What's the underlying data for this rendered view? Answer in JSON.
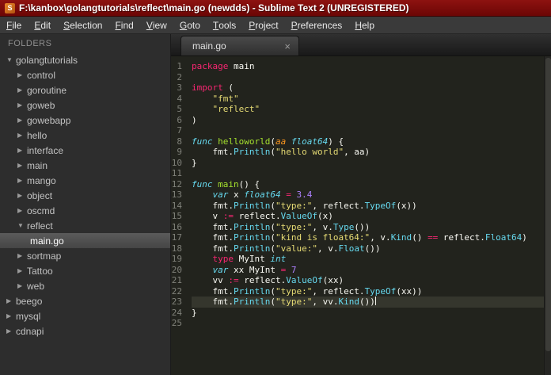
{
  "window": {
    "title": "F:\\kanbox\\golangtutorials\\reflect\\main.go (newdds) - Sublime Text 2 (UNREGISTERED)",
    "app_icon_letter": "S"
  },
  "menu": {
    "items": [
      "File",
      "Edit",
      "Selection",
      "Find",
      "View",
      "Goto",
      "Tools",
      "Project",
      "Preferences",
      "Help"
    ]
  },
  "sidebar": {
    "header": "FOLDERS",
    "items": [
      {
        "label": "golangtutorials",
        "indent": 0,
        "type": "folder",
        "expanded": true
      },
      {
        "label": "control",
        "indent": 1,
        "type": "folder",
        "expanded": false
      },
      {
        "label": "goroutine",
        "indent": 1,
        "type": "folder",
        "expanded": false
      },
      {
        "label": "goweb",
        "indent": 1,
        "type": "folder",
        "expanded": false
      },
      {
        "label": "gowebapp",
        "indent": 1,
        "type": "folder",
        "expanded": false
      },
      {
        "label": "hello",
        "indent": 1,
        "type": "folder",
        "expanded": false
      },
      {
        "label": "interface",
        "indent": 1,
        "type": "folder",
        "expanded": false
      },
      {
        "label": "main",
        "indent": 1,
        "type": "folder",
        "expanded": false
      },
      {
        "label": "mango",
        "indent": 1,
        "type": "folder",
        "expanded": false
      },
      {
        "label": "object",
        "indent": 1,
        "type": "folder",
        "expanded": false
      },
      {
        "label": "oscmd",
        "indent": 1,
        "type": "folder",
        "expanded": false
      },
      {
        "label": "reflect",
        "indent": 1,
        "type": "folder",
        "expanded": true
      },
      {
        "label": "main.go",
        "indent": 2,
        "type": "file",
        "selected": true
      },
      {
        "label": "sortmap",
        "indent": 1,
        "type": "folder",
        "expanded": false
      },
      {
        "label": "Tattoo",
        "indent": 1,
        "type": "folder",
        "expanded": false
      },
      {
        "label": "web",
        "indent": 1,
        "type": "folder",
        "expanded": false
      },
      {
        "label": "beego",
        "indent": 0,
        "type": "folder",
        "expanded": false
      },
      {
        "label": "mysql",
        "indent": 0,
        "type": "folder",
        "expanded": false
      },
      {
        "label": "cdnapi",
        "indent": 0,
        "type": "folder",
        "expanded": false
      }
    ]
  },
  "tabs": [
    {
      "label": "main.go",
      "active": true,
      "close_glyph": "×"
    }
  ],
  "colors": {
    "title_bar": "#7c0b0b",
    "editor_bg": "#22231d",
    "current_line_bg": "#35362d",
    "kw": "#f92672",
    "st": "#66d9ef",
    "fn": "#a6e22e",
    "str": "#e6db74",
    "num": "#ae81ff",
    "call": "#66d9ef",
    "param": "#fd971f",
    "plain": "#f8f8f2"
  },
  "editor": {
    "language": "Go",
    "lines": [
      {
        "num": 1,
        "segments": [
          {
            "t": "package",
            "c": "kw"
          },
          {
            "t": " main",
            "c": "plain"
          }
        ]
      },
      {
        "num": 2,
        "segments": []
      },
      {
        "num": 3,
        "segments": [
          {
            "t": "import",
            "c": "kw"
          },
          {
            "t": " (",
            "c": "plain"
          }
        ]
      },
      {
        "num": 4,
        "segments": [
          {
            "t": "    ",
            "c": "plain"
          },
          {
            "t": "\"fmt\"",
            "c": "str"
          }
        ]
      },
      {
        "num": 5,
        "segments": [
          {
            "t": "    ",
            "c": "plain"
          },
          {
            "t": "\"reflect\"",
            "c": "str"
          }
        ]
      },
      {
        "num": 6,
        "segments": [
          {
            "t": ")",
            "c": "plain"
          }
        ]
      },
      {
        "num": 7,
        "segments": []
      },
      {
        "num": 8,
        "segments": [
          {
            "t": "func",
            "c": "st"
          },
          {
            "t": " ",
            "c": "plain"
          },
          {
            "t": "helloworld",
            "c": "fn"
          },
          {
            "t": "(",
            "c": "plain"
          },
          {
            "t": "aa",
            "c": "param"
          },
          {
            "t": " ",
            "c": "plain"
          },
          {
            "t": "float64",
            "c": "st"
          },
          {
            "t": ") {",
            "c": "plain"
          }
        ]
      },
      {
        "num": 9,
        "segments": [
          {
            "t": "    fmt.",
            "c": "plain"
          },
          {
            "t": "Println",
            "c": "call"
          },
          {
            "t": "(",
            "c": "plain"
          },
          {
            "t": "\"hello world\"",
            "c": "str"
          },
          {
            "t": ", aa)",
            "c": "plain"
          }
        ]
      },
      {
        "num": 10,
        "segments": [
          {
            "t": "}",
            "c": "plain"
          }
        ]
      },
      {
        "num": 11,
        "segments": []
      },
      {
        "num": 12,
        "segments": [
          {
            "t": "func",
            "c": "st"
          },
          {
            "t": " ",
            "c": "plain"
          },
          {
            "t": "main",
            "c": "fn"
          },
          {
            "t": "() {",
            "c": "plain"
          }
        ]
      },
      {
        "num": 13,
        "segments": [
          {
            "t": "    ",
            "c": "plain"
          },
          {
            "t": "var",
            "c": "st"
          },
          {
            "t": " x ",
            "c": "plain"
          },
          {
            "t": "float64",
            "c": "st"
          },
          {
            "t": " ",
            "c": "plain"
          },
          {
            "t": "=",
            "c": "kw"
          },
          {
            "t": " ",
            "c": "plain"
          },
          {
            "t": "3.4",
            "c": "num"
          }
        ]
      },
      {
        "num": 14,
        "segments": [
          {
            "t": "    fmt.",
            "c": "plain"
          },
          {
            "t": "Println",
            "c": "call"
          },
          {
            "t": "(",
            "c": "plain"
          },
          {
            "t": "\"type:\"",
            "c": "str"
          },
          {
            "t": ", reflect.",
            "c": "plain"
          },
          {
            "t": "TypeOf",
            "c": "call"
          },
          {
            "t": "(x))",
            "c": "plain"
          }
        ]
      },
      {
        "num": 15,
        "segments": [
          {
            "t": "    v ",
            "c": "plain"
          },
          {
            "t": ":=",
            "c": "kw"
          },
          {
            "t": " reflect.",
            "c": "plain"
          },
          {
            "t": "ValueOf",
            "c": "call"
          },
          {
            "t": "(x)",
            "c": "plain"
          }
        ]
      },
      {
        "num": 16,
        "segments": [
          {
            "t": "    fmt.",
            "c": "plain"
          },
          {
            "t": "Println",
            "c": "call"
          },
          {
            "t": "(",
            "c": "plain"
          },
          {
            "t": "\"type:\"",
            "c": "str"
          },
          {
            "t": ", v.",
            "c": "plain"
          },
          {
            "t": "Type",
            "c": "call"
          },
          {
            "t": "())",
            "c": "plain"
          }
        ]
      },
      {
        "num": 17,
        "segments": [
          {
            "t": "    fmt.",
            "c": "plain"
          },
          {
            "t": "Println",
            "c": "call"
          },
          {
            "t": "(",
            "c": "plain"
          },
          {
            "t": "\"kind is float64:\"",
            "c": "str"
          },
          {
            "t": ", v.",
            "c": "plain"
          },
          {
            "t": "Kind",
            "c": "call"
          },
          {
            "t": "() ",
            "c": "plain"
          },
          {
            "t": "==",
            "c": "kw"
          },
          {
            "t": " reflect.",
            "c": "plain"
          },
          {
            "t": "Float64",
            "c": "call"
          },
          {
            "t": ")",
            "c": "plain"
          }
        ]
      },
      {
        "num": 18,
        "segments": [
          {
            "t": "    fmt.",
            "c": "plain"
          },
          {
            "t": "Println",
            "c": "call"
          },
          {
            "t": "(",
            "c": "plain"
          },
          {
            "t": "\"value:\"",
            "c": "str"
          },
          {
            "t": ", v.",
            "c": "plain"
          },
          {
            "t": "Float",
            "c": "call"
          },
          {
            "t": "())",
            "c": "plain"
          }
        ]
      },
      {
        "num": 19,
        "segments": [
          {
            "t": "    ",
            "c": "plain"
          },
          {
            "t": "type",
            "c": "kw"
          },
          {
            "t": " MyInt ",
            "c": "plain"
          },
          {
            "t": "int",
            "c": "st"
          }
        ]
      },
      {
        "num": 20,
        "segments": [
          {
            "t": "    ",
            "c": "plain"
          },
          {
            "t": "var",
            "c": "st"
          },
          {
            "t": " xx MyInt ",
            "c": "plain"
          },
          {
            "t": "=",
            "c": "kw"
          },
          {
            "t": " ",
            "c": "plain"
          },
          {
            "t": "7",
            "c": "num"
          }
        ]
      },
      {
        "num": 21,
        "segments": [
          {
            "t": "    vv ",
            "c": "plain"
          },
          {
            "t": ":=",
            "c": "kw"
          },
          {
            "t": " reflect.",
            "c": "plain"
          },
          {
            "t": "ValueOf",
            "c": "call"
          },
          {
            "t": "(xx)",
            "c": "plain"
          }
        ]
      },
      {
        "num": 22,
        "segments": [
          {
            "t": "    fmt.",
            "c": "plain"
          },
          {
            "t": "Println",
            "c": "call"
          },
          {
            "t": "(",
            "c": "plain"
          },
          {
            "t": "\"type:\"",
            "c": "str"
          },
          {
            "t": ", reflect.",
            "c": "plain"
          },
          {
            "t": "TypeOf",
            "c": "call"
          },
          {
            "t": "(xx))",
            "c": "plain"
          }
        ]
      },
      {
        "num": 23,
        "current": true,
        "cursor": true,
        "segments": [
          {
            "t": "    fmt.",
            "c": "plain"
          },
          {
            "t": "Println",
            "c": "call"
          },
          {
            "t": "(",
            "c": "plain"
          },
          {
            "t": "\"type:\"",
            "c": "str"
          },
          {
            "t": ", vv.",
            "c": "plain"
          },
          {
            "t": "Kind",
            "c": "call"
          },
          {
            "t": "())",
            "c": "plain"
          }
        ]
      },
      {
        "num": 24,
        "segments": [
          {
            "t": "}",
            "c": "plain"
          }
        ]
      },
      {
        "num": 25,
        "segments": []
      }
    ]
  }
}
